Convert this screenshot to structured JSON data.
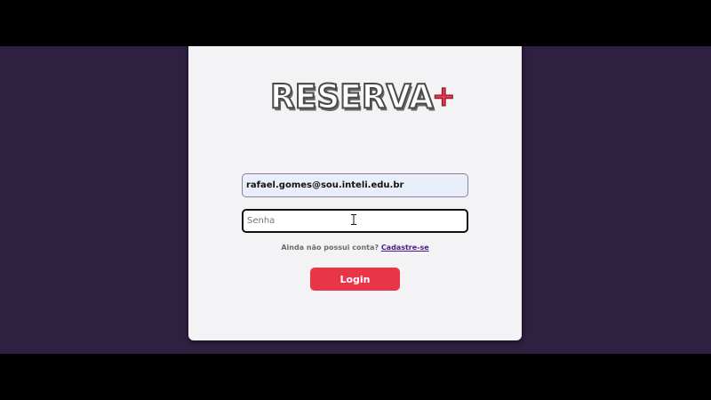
{
  "brand": {
    "name": "RESERVA",
    "symbol": "+",
    "accent_color": "#e8354a"
  },
  "form": {
    "email": {
      "value": "rafael.gomes@sou.inteli.edu.br"
    },
    "password": {
      "placeholder": "Senha",
      "value": ""
    },
    "signup_prompt": "Ainda não possui conta?",
    "signup_link": "Cadastre-se",
    "login_label": "Login"
  },
  "colors": {
    "background": "#2e2041",
    "card": "#f3f3f5",
    "link": "#4a1a8a"
  },
  "icons": {
    "cursor": "text-cursor-icon"
  }
}
